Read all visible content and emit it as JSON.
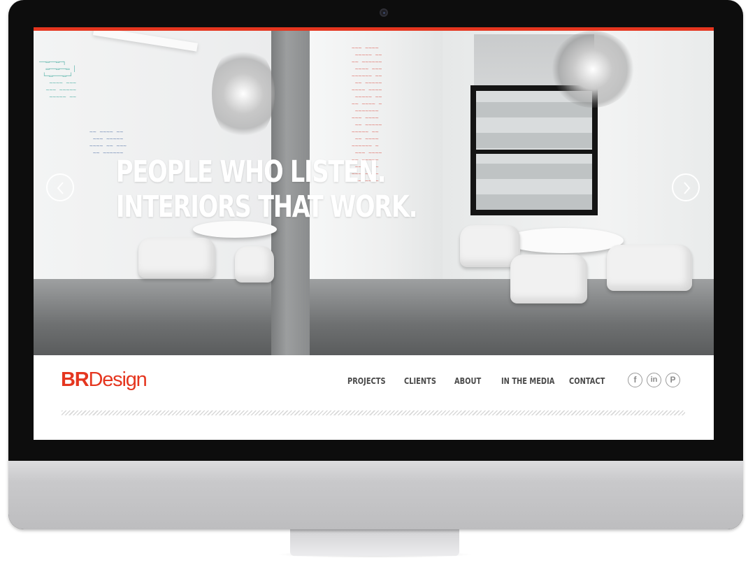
{
  "site": {
    "brand": {
      "part1": "BR",
      "part2": "Design"
    },
    "accent_color": "#e5361f"
  },
  "hero": {
    "headline_line1": "PEOPLE WHO LISTEN.",
    "headline_line2": "INTERIORS THAT WORK.",
    "prev_icon": "chevron-left-icon",
    "next_icon": "chevron-right-icon"
  },
  "nav": {
    "items": [
      {
        "label": "PROJECTS"
      },
      {
        "label": "CLIENTS"
      },
      {
        "label": "ABOUT"
      },
      {
        "label": "IN THE MEDIA"
      },
      {
        "label": "CONTACT"
      }
    ]
  },
  "social": {
    "facebook": {
      "glyph": "f",
      "icon": "facebook-icon"
    },
    "linkedin": {
      "glyph": "in",
      "icon": "linkedin-icon"
    },
    "pinterest": {
      "glyph": "P",
      "icon": "pinterest-icon"
    }
  }
}
